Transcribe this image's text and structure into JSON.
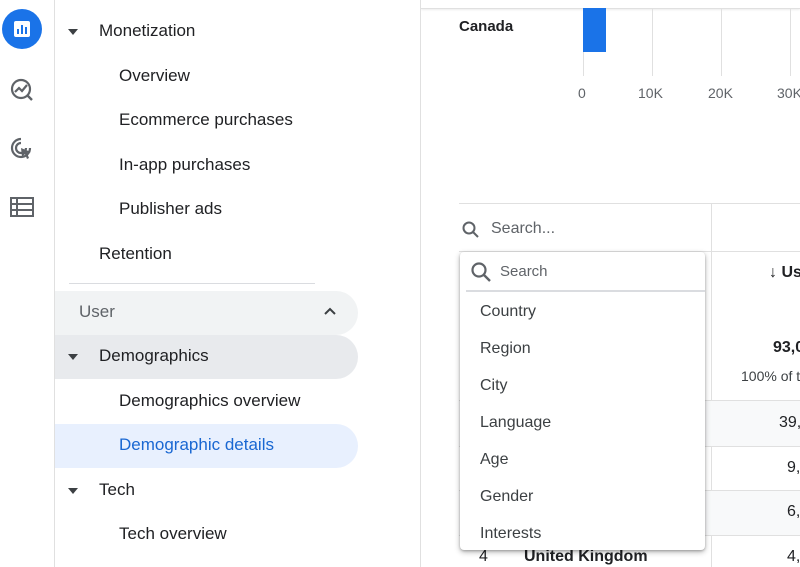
{
  "nav": {
    "monetization": "Monetization",
    "overview": "Overview",
    "ecommerce": "Ecommerce purchases",
    "inapp": "In-app purchases",
    "publisher": "Publisher ads",
    "retention": "Retention",
    "user_section": "User",
    "demographics": "Demographics",
    "demographics_overview": "Demographics overview",
    "demographic_details": "Demographic details",
    "tech": "Tech",
    "tech_overview": "Tech overview"
  },
  "chart": {
    "bar_label": "Canada",
    "x_ticks": [
      "0",
      "10K",
      "20K",
      "30K"
    ]
  },
  "chart_data": {
    "type": "bar",
    "categories": [
      "Canada"
    ],
    "values": [
      3300
    ],
    "xlim": [
      0,
      30000
    ]
  },
  "table": {
    "search_placeholder": "Search...",
    "col_header": "↓ Us",
    "total_value": "93,0",
    "total_pct": "100% of t",
    "rows": [
      {
        "value": "39,"
      },
      {
        "value": "9,"
      },
      {
        "value": "6,"
      },
      {
        "rank": "4",
        "country": "United Kingdom",
        "value": "4,"
      }
    ]
  },
  "dropdown": {
    "search_placeholder": "Search",
    "options": [
      "Country",
      "Region",
      "City",
      "Language",
      "Age",
      "Gender",
      "Interests"
    ]
  },
  "colors": {
    "accent": "#1a73e8",
    "selected_bg": "#e8f0fe",
    "hover_bg": "#e8eaed"
  }
}
